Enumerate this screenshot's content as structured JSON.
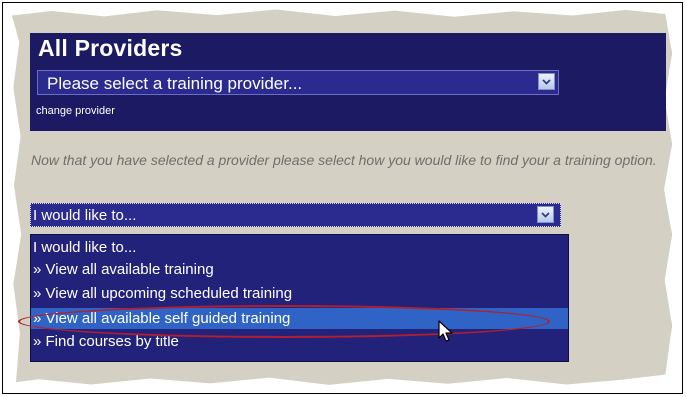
{
  "header": {
    "title": "All Providers",
    "provider_select_value": "Please select a training provider...",
    "change_provider_label": "change provider"
  },
  "instruction": "Now that you have selected a provider please select how you would like to find your a training option.",
  "dropdown": {
    "value": "I would like to...",
    "options": [
      "I would like to...",
      "» View all available training",
      "» View all upcoming scheduled training",
      "» View all available self guided training",
      "» Find courses by title"
    ],
    "highlighted_index": 3
  },
  "colors": {
    "header_bg": "#1c1a63",
    "select_bg": "#2b2a8f",
    "list_bg": "#23227b",
    "highlight": "#2f64c6",
    "annotation": "#b21f2c",
    "panel_bg": "#d4d0c3"
  },
  "icons": [
    "chevron-down-icon",
    "mouse-pointer-icon"
  ]
}
